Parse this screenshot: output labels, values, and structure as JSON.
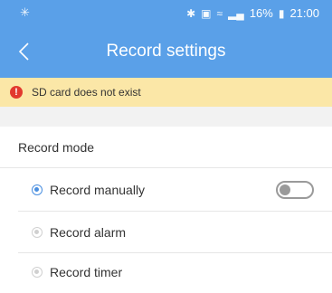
{
  "status_bar": {
    "left_icon": "app-notification-icon",
    "battery_percent": "16%",
    "time": "21:00"
  },
  "header": {
    "title": "Record settings",
    "back_icon": "chevron-left-icon"
  },
  "alert": {
    "message": "SD card does not exist",
    "icon": "exclamation-icon",
    "icon_text": "!"
  },
  "record_mode": {
    "label": "Record mode",
    "options": [
      {
        "label": "Record manually",
        "selected": true
      },
      {
        "label": "Record alarm",
        "selected": false
      },
      {
        "label": "Record timer",
        "selected": false
      }
    ],
    "manual_toggle_on": false
  },
  "colors": {
    "header_bg": "#5aa0e8",
    "alert_bg": "#fbe7a7",
    "alert_icon": "#e2392e",
    "radio_active": "#4a8fe0"
  }
}
